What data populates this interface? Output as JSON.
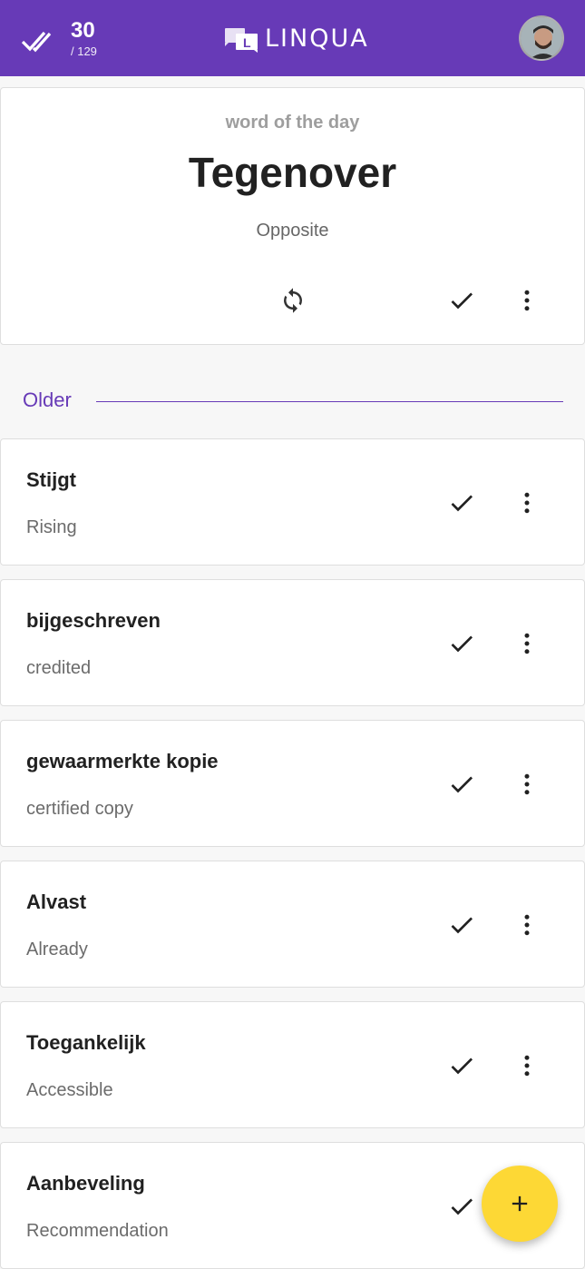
{
  "header": {
    "progress_count": "30",
    "progress_total": "/ 129",
    "brand_name": "LINQUA",
    "progress_icon": "double-check-icon",
    "brand_icon": "linqua-logo",
    "avatar": "user-avatar"
  },
  "word_of_the_day": {
    "kicker": "word of the day",
    "word": "Tegenover",
    "translation": "Opposite",
    "actions": [
      "refresh-icon",
      "check-icon",
      "more-vert-icon"
    ]
  },
  "section": {
    "label": "Older"
  },
  "items": [
    {
      "term": "Stijgt",
      "meaning": "Rising"
    },
    {
      "term": "bijgeschreven",
      "meaning": "credited"
    },
    {
      "term": "gewaarmerkte kopie",
      "meaning": "certified copy"
    },
    {
      "term": "Alvast",
      "meaning": "Already"
    },
    {
      "term": "Toegankelijk",
      "meaning": "Accessible"
    },
    {
      "term": "Aanbeveling",
      "meaning": "Recommendation"
    }
  ],
  "fab": {
    "icon": "plus-icon"
  },
  "colors": {
    "primary": "#673ab7",
    "accent": "#fdd835",
    "background": "#f7f7f7"
  }
}
